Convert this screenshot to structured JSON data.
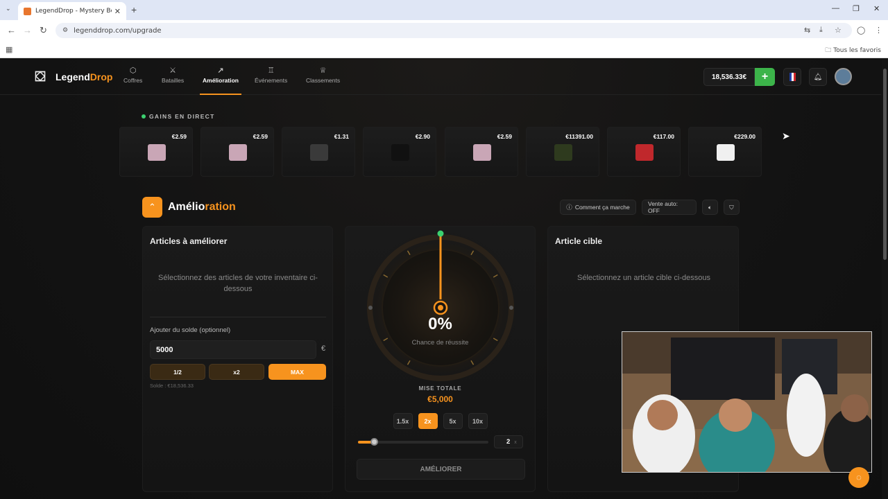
{
  "browser": {
    "tab_title": "LegendDrop - Mystery Boxes &",
    "url": "legenddrop.com/upgrade",
    "bookmarks_label": "Tous les favoris"
  },
  "header": {
    "logo_a": "Legend",
    "logo_b": "Drop",
    "nav": [
      {
        "label": "Coffres",
        "icon": "cube-icon"
      },
      {
        "label": "Batailles",
        "icon": "swords-icon"
      },
      {
        "label": "Amélioration",
        "icon": "trending-up-icon",
        "active": true
      },
      {
        "label": "Événements",
        "icon": "trophy-icon"
      },
      {
        "label": "Classements",
        "icon": "crown-icon"
      }
    ],
    "balance": "18,536.33€",
    "add": "+"
  },
  "live": {
    "title": "GAINS EN DIRECT",
    "drops": [
      {
        "price": "€2.59",
        "color": "#c9a6b6"
      },
      {
        "price": "€2.59",
        "color": "#c9a6b6"
      },
      {
        "price": "€1.31",
        "color": "#3a3a3a"
      },
      {
        "price": "€2.90",
        "color": "#111111"
      },
      {
        "price": "€2.59",
        "color": "#c9a6b6"
      },
      {
        "price": "€11391.00",
        "color": "#2e3a1e"
      },
      {
        "price": "€117.00",
        "color": "#c0282c"
      },
      {
        "price": "€229.00",
        "color": "#f0f0f0"
      }
    ]
  },
  "section": {
    "title_a": "Amélio",
    "title_b": "ration",
    "how": "Comment ça marche",
    "auto_sell": "Vente auto: OFF"
  },
  "left": {
    "title": "Articles à améliorer",
    "hint": "Sélectionnez des articles de votre inventaire ci-dessous",
    "add_label": "Ajouter du solde (optionnel)",
    "amount": "5000",
    "currency": "€",
    "half": "1/2",
    "double": "x2",
    "max": "MAX",
    "solde": "Solde : €18,536.33"
  },
  "center": {
    "percent": "0%",
    "chance": "Chance de réussite",
    "mise_label": "MISE TOTALE",
    "mise_value": "€5,000",
    "multipliers": [
      "1.5x",
      "2x",
      "5x",
      "10x"
    ],
    "selected_multiplier": "2x",
    "multiplier_value": "2",
    "multiplier_suffix": "x",
    "slider_fraction": 0.12,
    "button": "AMÉLIORER"
  },
  "right": {
    "title": "Article cible",
    "hint": "Sélectionnez un article cible ci-dessous"
  },
  "colors": {
    "accent": "#f7931e",
    "green": "#3cb44a"
  }
}
